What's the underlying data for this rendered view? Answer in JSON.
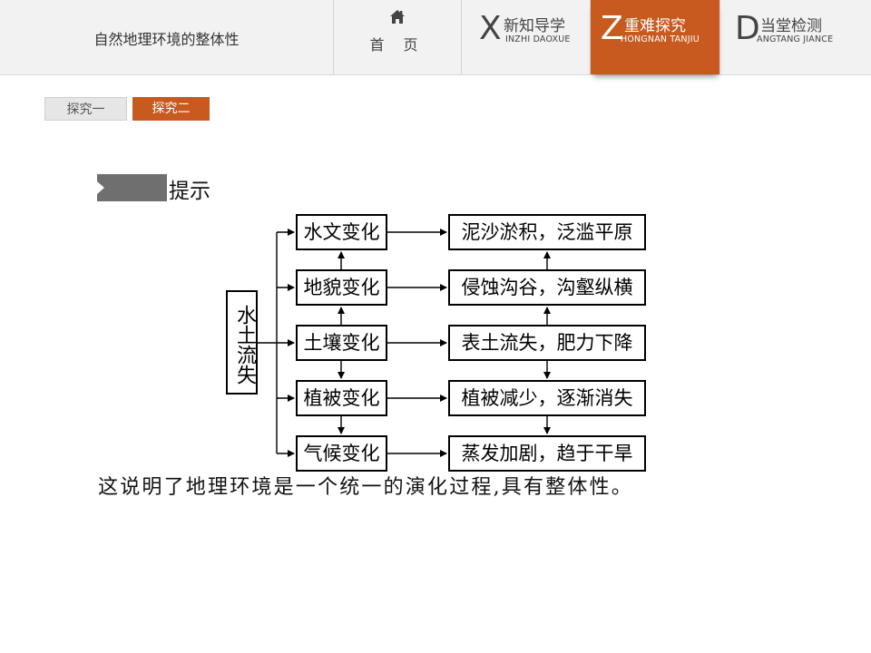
{
  "header": {
    "lesson_title": "自然地理环境的整体性",
    "home_label": "首 页",
    "tabs": [
      {
        "letter": "X",
        "label": "新知导学",
        "pinyin": "INZHI DAOXUE",
        "active": false
      },
      {
        "letter": "Z",
        "label": "重难探究",
        "pinyin": "HONGNAN TANJIU",
        "active": true
      },
      {
        "letter": "D",
        "label": "当堂检测",
        "pinyin": "ANGTANG JIANCE",
        "active": false
      }
    ]
  },
  "subtabs": [
    {
      "label": "探究一",
      "active": false
    },
    {
      "label": "探究二",
      "active": true
    }
  ],
  "hint": {
    "label": "提示"
  },
  "diagram": {
    "source": "水土流失",
    "changes": [
      "水文变化",
      "地貌变化",
      "土壤变化",
      "植被变化",
      "气候变化"
    ],
    "results": [
      "泥沙淤积，泛滥平原",
      "侵蚀沟谷，沟壑纵横",
      "表土流失，肥力下降",
      "植被减少，逐渐消失",
      "蒸发加剧，趋于干旱"
    ]
  },
  "conclusion": "这说明了地理环境是一个统一的演化过程,具有整体性。",
  "colors": {
    "accent": "#c85a1f",
    "bar": "#f2f2f2"
  },
  "icons": {
    "home": "home-icon"
  }
}
